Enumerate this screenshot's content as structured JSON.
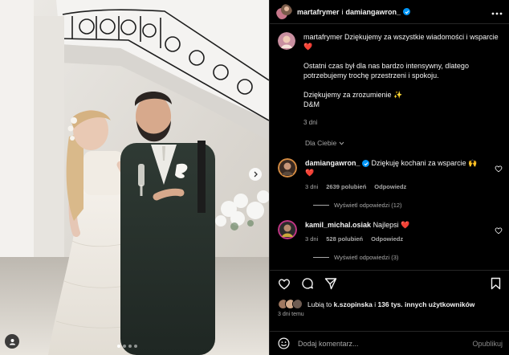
{
  "header": {
    "author": "martafrymer",
    "joiner": "i",
    "coauthor": "damiangawron_",
    "more_icon": "more-horizontal-icon"
  },
  "caption": {
    "username": "martafrymer",
    "line1": "Dziękujemy za wszystkie wiadomości i wsparcie",
    "line1_emoji": "❤️",
    "paragraph2": "Ostatni czas był dla nas bardzo intensywny, dlatego potrzebujemy trochę przestrzeni i spokoju.",
    "line3": "Dziękujemy za zrozumienie",
    "line3_emoji": "✨",
    "signature": "D&M",
    "time": "3 dni"
  },
  "for_you": "Dla Ciebie",
  "comments": [
    {
      "username": "damiangawron_",
      "text": "Dziękuję kochani za wsparcie",
      "emoji": "🙌 ❤️",
      "time": "3 dni",
      "likes": "2639 polubień",
      "reply": "Odpowiedz",
      "view_replies": "Wyświetl odpowiedzi (12)"
    },
    {
      "username": "kamil_michal.osiak",
      "text": "Najlepsi",
      "emoji": "❤️",
      "time": "3 dni",
      "likes": "528 polubień",
      "reply": "Odpowiedz",
      "view_replies": "Wyświetl odpowiedzi (3)"
    }
  ],
  "likes": {
    "prefix": "Lubią to",
    "user": "k.szopinska",
    "joiner": "i",
    "rest": "136 tys. innych użytkowników"
  },
  "posted": "3 dni temu",
  "composer": {
    "placeholder": "Dodaj komentarz...",
    "publish": "Opublikuj"
  },
  "colors": {
    "background": "#000000",
    "verified": "#0095f6",
    "heart": "#ff3040",
    "muted": "#a8a8a8"
  }
}
